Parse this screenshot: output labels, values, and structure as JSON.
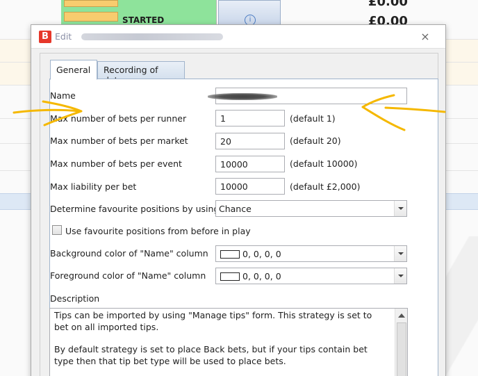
{
  "background": {
    "row_status": "STARTED",
    "price_top": "£0.00",
    "price_bottom": "£0.00"
  },
  "dialog": {
    "title_prefix": "Edit",
    "logo_letter": "B",
    "close_glyph": "⨯"
  },
  "tabs": [
    {
      "label": "General",
      "active": true
    },
    {
      "label": "Recording of data",
      "active": false
    }
  ],
  "form": {
    "name_label": "Name",
    "max_bets_runner_label": "Max number of bets per runner",
    "max_bets_runner_value": "1",
    "max_bets_runner_hint": "(default 1)",
    "max_bets_market_label": "Max number of bets per market",
    "max_bets_market_value": "20",
    "max_bets_market_hint": "(default 20)",
    "max_bets_event_label": "Max number of bets per event",
    "max_bets_event_value": "10000",
    "max_bets_event_hint": "(default 10000)",
    "max_liability_label": "Max liability per bet",
    "max_liability_value": "10000",
    "max_liability_hint": "(default £2,000)",
    "fav_positions_label": "Determine favourite positions by using",
    "fav_positions_value": "Chance",
    "use_fav_before_inplay_label": "Use favourite positions from before in play",
    "bg_color_label": "Background color of \"Name\" column",
    "bg_color_value": "0, 0, 0, 0",
    "fg_color_label": "Foreground color of \"Name\" column",
    "fg_color_value": "0, 0, 0, 0",
    "description_label": "Description",
    "description_p1": "Tips can be imported by using \"Manage tips\" form. This strategy is set to bet on all imported tips.",
    "description_p2": "By default strategy is set to place Back bets, but if your tips contain bet type then that tip bet type will be used to place bets."
  },
  "colors": {
    "annotation_arrow": "#f5b800",
    "logo_red": "#e6372a",
    "tab_border": "#a0b4cc"
  }
}
